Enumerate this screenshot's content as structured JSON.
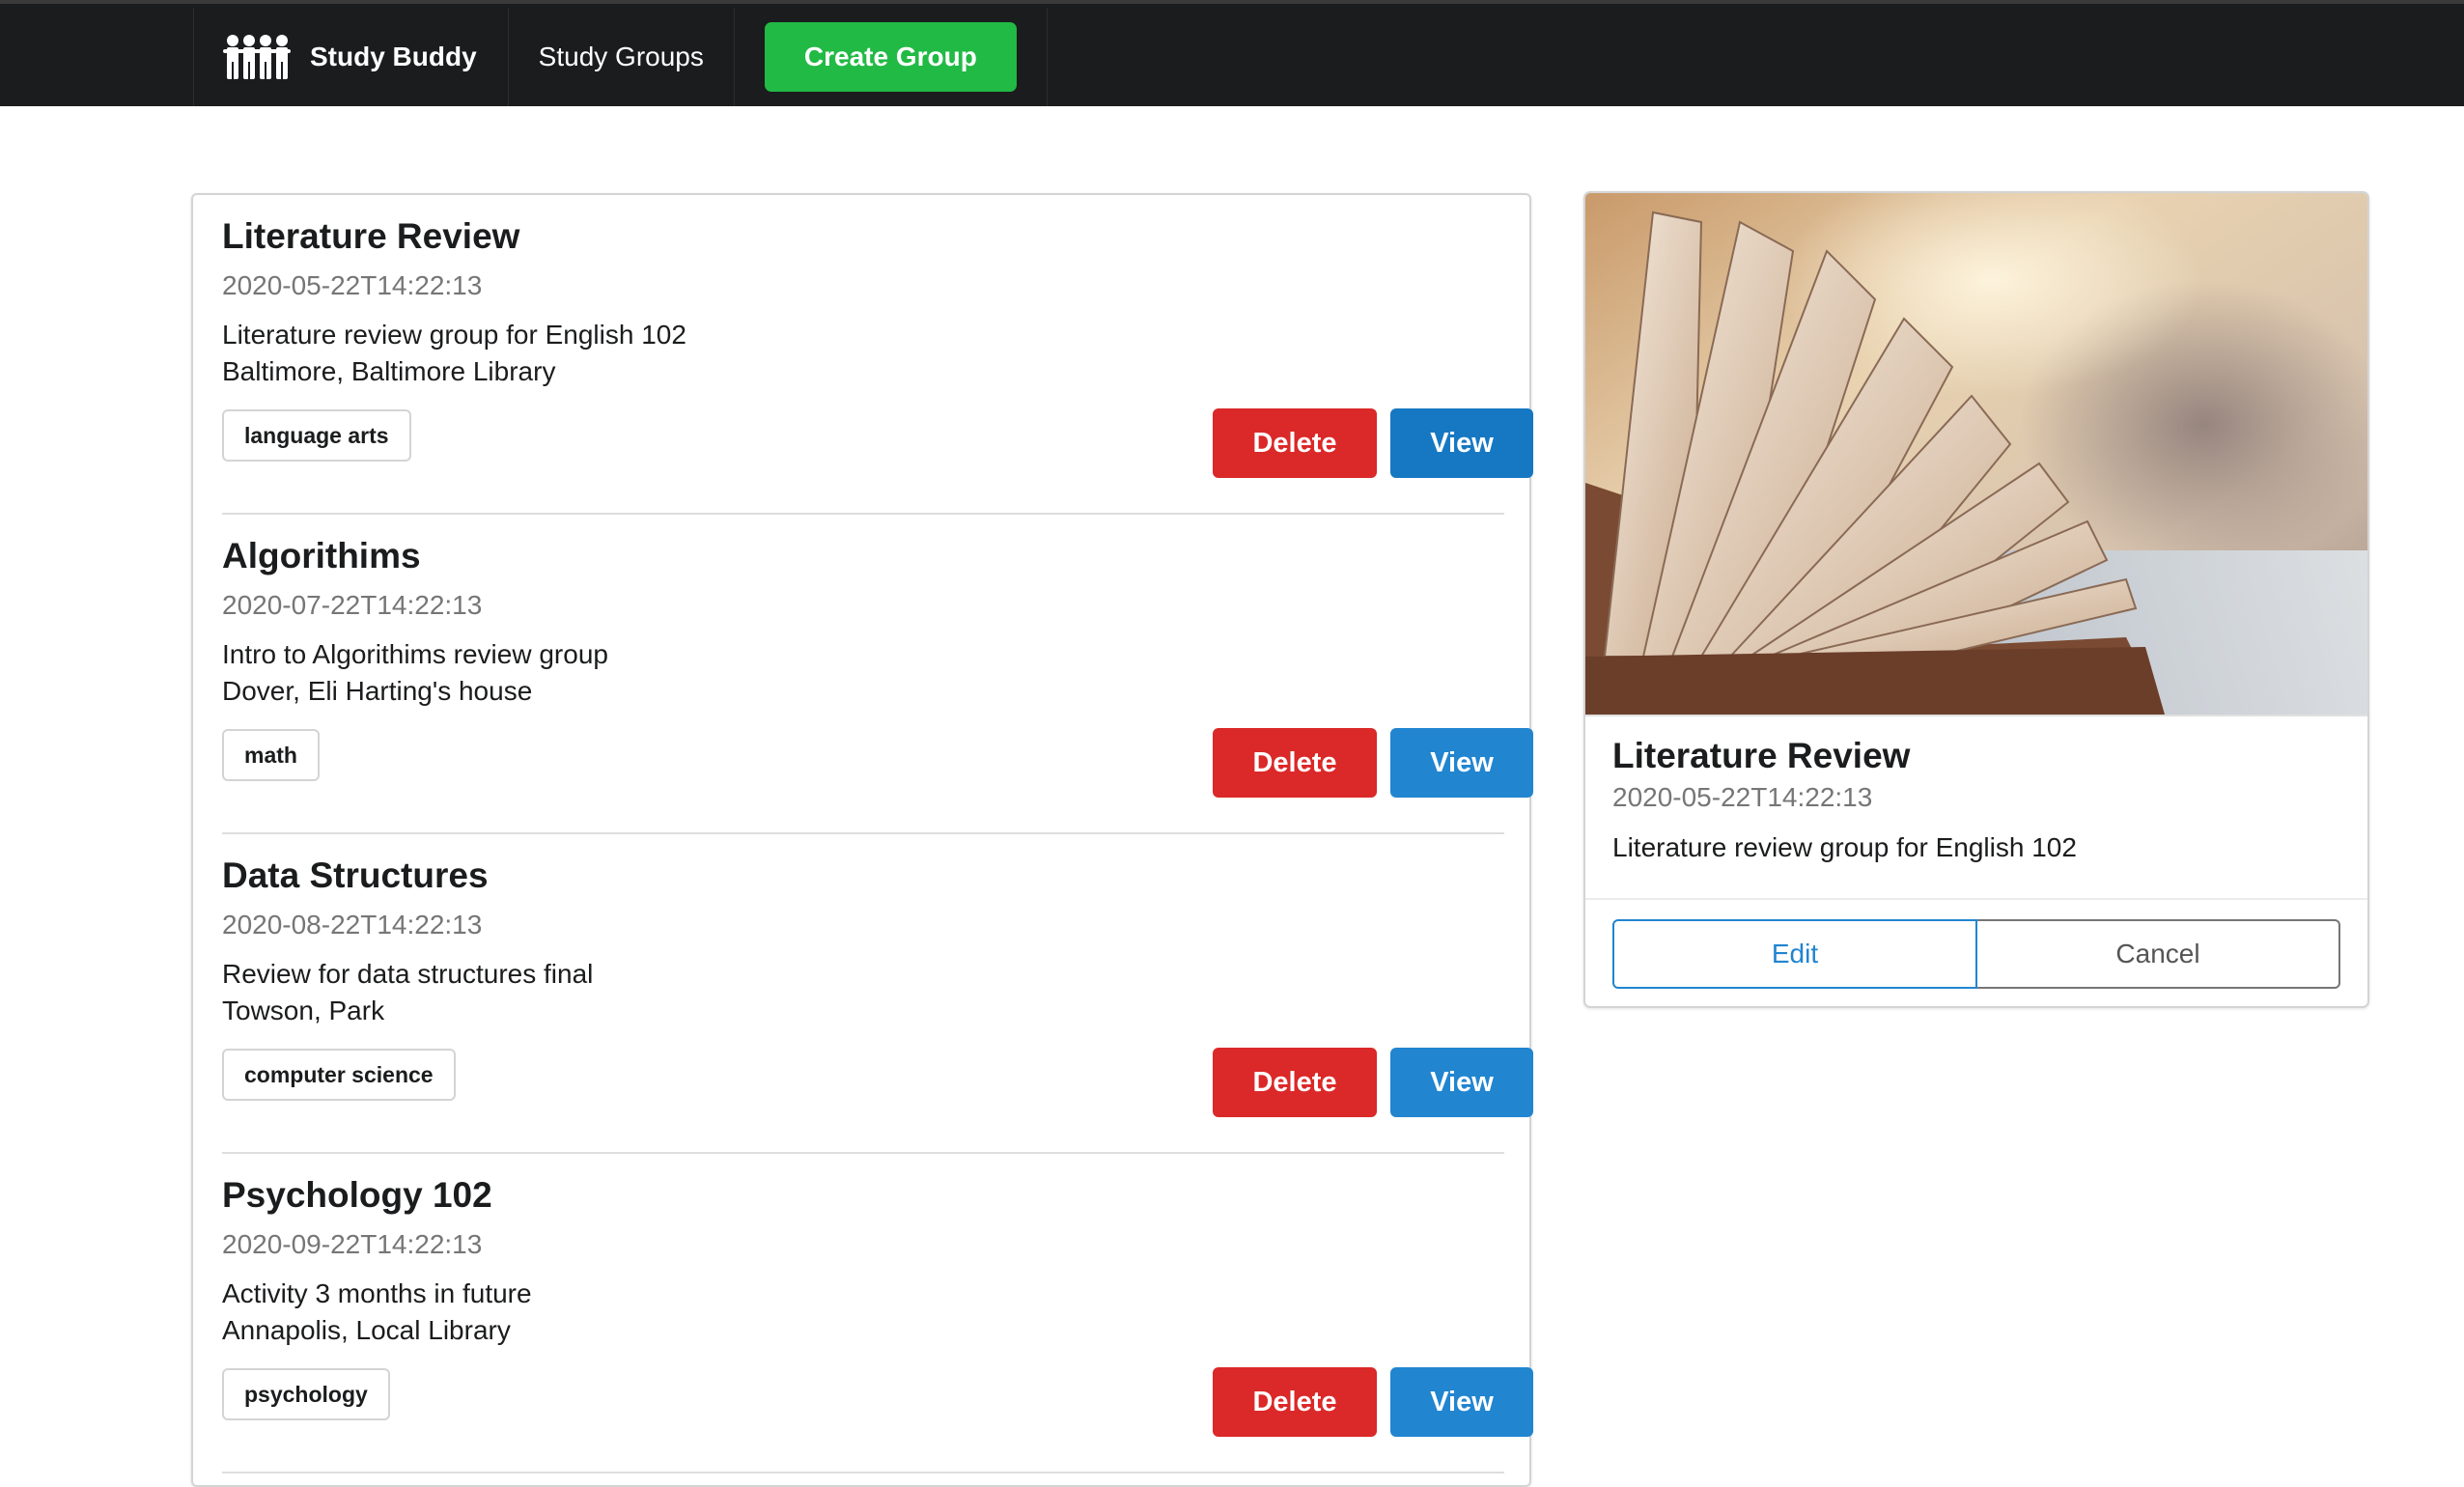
{
  "nav": {
    "brand": "Study Buddy",
    "study_groups": "Study Groups",
    "create_group": "Create Group"
  },
  "colors": {
    "nav_bg": "#1b1c1d",
    "create_green": "#21ba45",
    "delete_red": "#db2828",
    "view_blue": "#2185d0"
  },
  "groups": [
    {
      "title": "Literature Review",
      "date": "2020-05-22T14:22:13",
      "description": "Literature review group for English 102",
      "location": "Baltimore, Baltimore Library",
      "category": "language arts",
      "delete_label": "Delete",
      "view_label": "View"
    },
    {
      "title": "Algorithims",
      "date": "2020-07-22T14:22:13",
      "description": "Intro to Algorithims review group",
      "location": "Dover, Eli Harting's house",
      "category": "math",
      "delete_label": "Delete",
      "view_label": "View"
    },
    {
      "title": "Data Structures",
      "date": "2020-08-22T14:22:13",
      "description": "Review for data structures final",
      "location": "Towson, Park",
      "category": "computer science",
      "delete_label": "Delete",
      "view_label": "View"
    },
    {
      "title": "Psychology 102",
      "date": "2020-09-22T14:22:13",
      "description": "Activity 3 months in future",
      "location": "Annapolis, Local Library",
      "category": "psychology",
      "delete_label": "Delete",
      "view_label": "View"
    }
  ],
  "selected": {
    "title": "Literature Review",
    "date": "2020-05-22T14:22:13",
    "description": "Literature review group for English 102",
    "image_icon": "open-book-photo",
    "edit_label": "Edit",
    "cancel_label": "Cancel"
  }
}
